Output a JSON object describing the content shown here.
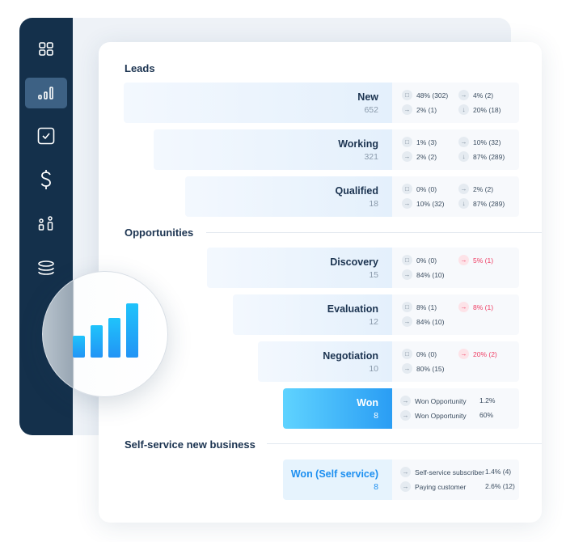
{
  "sidebar": {
    "items": [
      {
        "icon": "grid-icon"
      },
      {
        "icon": "bar-chart-icon",
        "active": true
      },
      {
        "icon": "checkbox-icon"
      },
      {
        "icon": "dollar-icon"
      },
      {
        "icon": "shapes-icon"
      },
      {
        "icon": "database-icon"
      }
    ]
  },
  "sections": {
    "leads": "Leads",
    "opportunities": "Opportunities",
    "self_service": "Self-service new business"
  },
  "stages": [
    {
      "name": "New",
      "count": "652",
      "metrics": [
        [
          "48% (302)",
          "4% (2)"
        ],
        [
          "2% (1)",
          "20% (18)"
        ]
      ]
    },
    {
      "name": "Working",
      "count": "321",
      "metrics": [
        [
          "1% (3)",
          "10% (32)"
        ],
        [
          "2% (2)",
          "87% (289)"
        ]
      ]
    },
    {
      "name": "Qualified",
      "count": "18",
      "metrics": [
        [
          "0% (0)",
          "2% (2)"
        ],
        [
          "10% (32)",
          "87% (289)"
        ]
      ]
    },
    {
      "name": "Discovery",
      "count": "15",
      "metrics": [
        [
          "0% (0)",
          "5% (1)"
        ],
        [
          "84% (10)"
        ]
      ]
    },
    {
      "name": "Evaluation",
      "count": "12",
      "metrics": [
        [
          "8% (1)",
          "8% (1)"
        ],
        [
          "84% (10)"
        ]
      ]
    },
    {
      "name": "Negotiation",
      "count": "10",
      "metrics": [
        [
          "0% (0)",
          "20% (2)"
        ],
        [
          "80% (15)"
        ]
      ]
    },
    {
      "name": "Won",
      "count": "8",
      "metrics": [
        [
          "Won Opportunity",
          "1.2%"
        ],
        [
          "Won Opportunity",
          "60%"
        ]
      ]
    },
    {
      "name": "Won (Self service)",
      "count": "8",
      "metrics": [
        [
          "Self-service subscriber",
          "1.4% (4)"
        ],
        [
          "Paying customer",
          "2.6% (12)"
        ]
      ]
    }
  ],
  "colors": {
    "sidebar": "#14304b",
    "accent": "#2a9df4",
    "negative": "#ef3d63"
  }
}
